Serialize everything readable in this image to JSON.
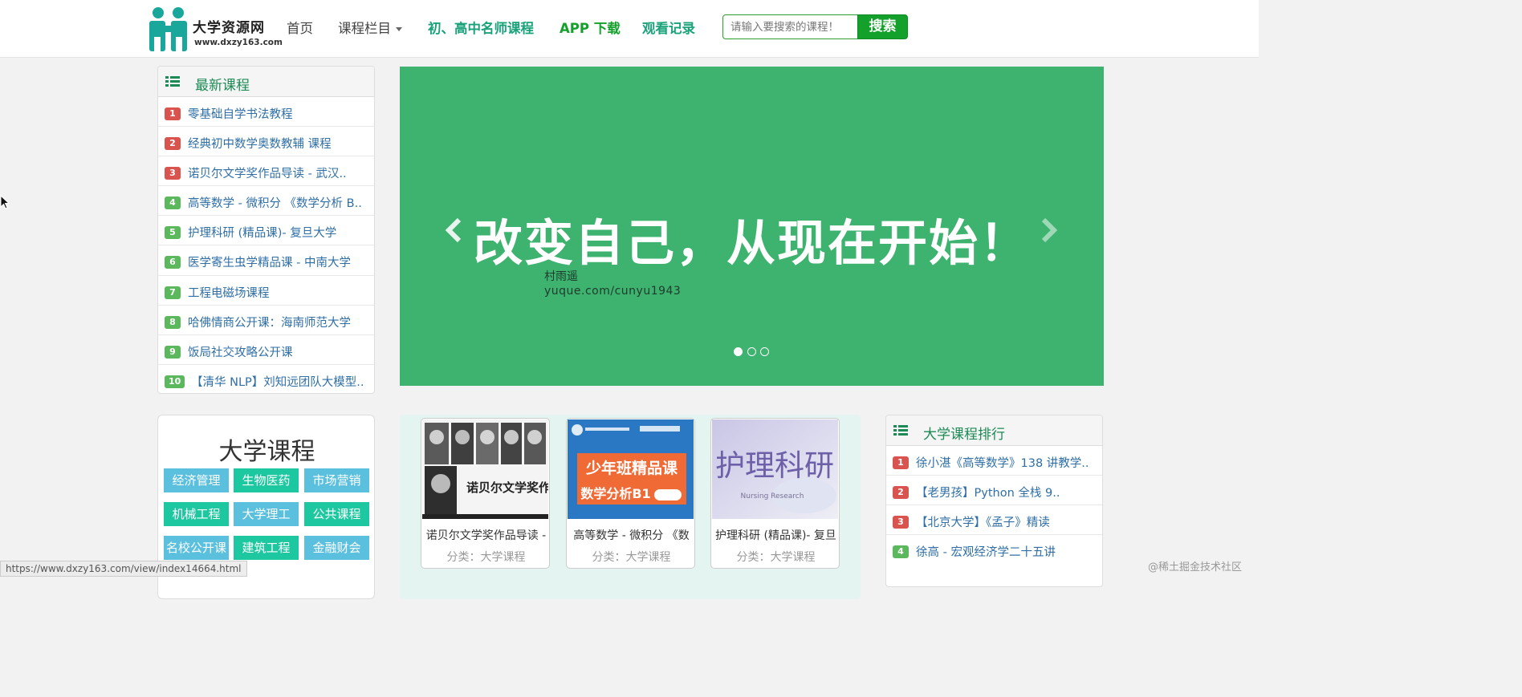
{
  "header": {
    "logo_name": "大学资源网",
    "logo_url": "www.dxzy163.com",
    "nav": {
      "home": "首页",
      "columns": "课程栏目",
      "teachers": "初、高中名师课程",
      "app": "APP 下载",
      "history": "观看记录"
    },
    "search": {
      "placeholder": "请输入要搜索的课程！",
      "button": "搜索"
    }
  },
  "latest": {
    "title": "最新课程",
    "items": [
      {
        "rank": "1",
        "text": "零基础自学书法教程"
      },
      {
        "rank": "2",
        "text": "经典初中数学奥数教辅 课程"
      },
      {
        "rank": "3",
        "text": "诺贝尔文学奖作品导读 - 武汉.."
      },
      {
        "rank": "4",
        "text": "高等数学 - 微积分 《数学分析 B.."
      },
      {
        "rank": "5",
        "text": "护理科研 (精品课)- 复旦大学"
      },
      {
        "rank": "6",
        "text": "医学寄生虫学精品课 - 中南大学"
      },
      {
        "rank": "7",
        "text": "工程电磁场课程"
      },
      {
        "rank": "8",
        "text": "哈佛情商公开课：海南师范大学"
      },
      {
        "rank": "9",
        "text": "饭局社交攻略公开课"
      },
      {
        "rank": "10",
        "text": "【清华 NLP】刘知远团队大模型.."
      }
    ]
  },
  "banner": {
    "slogan": "改变自己，从现在开始！",
    "watermark_name": "村雨遥",
    "watermark_url": "yuque.com/cunyu1943"
  },
  "categories": {
    "title": "大学课程",
    "tags": [
      "经济管理",
      "生物医药",
      "市场营销",
      "机械工程",
      "大学理工",
      "公共课程",
      "名校公开课",
      "建筑工程",
      "金融财会"
    ]
  },
  "courses": [
    {
      "title": "诺贝尔文学奖作品导读 -",
      "category": "分类：大学课程",
      "thumb_text": "诺贝尔文学奖作品导读"
    },
    {
      "title": "高等数学 - 微积分 《数",
      "category": "分类：大学课程",
      "thumb_text": "少年班精品课",
      "thumb_sub": "数学分析B1"
    },
    {
      "title": "护理科研 (精品课)- 复旦",
      "category": "分类：大学课程",
      "thumb_text": "护理科研",
      "thumb_sub": "Nursing Research"
    }
  ],
  "ranking": {
    "title": "大学课程排行",
    "items": [
      {
        "rank": "1",
        "text": "徐小湛《高等数学》138 讲教学.."
      },
      {
        "rank": "2",
        "text": "【老男孩】Python 全栈 9.."
      },
      {
        "rank": "3",
        "text": "【北京大学】《孟子》精读"
      },
      {
        "rank": "4",
        "text": "徐高 - 宏观经济学二十五讲"
      }
    ]
  },
  "status": {
    "url": "https://www.dxzy163.com/view/index14664.html",
    "corner_watermark": "@稀土掘金技术社区"
  },
  "colors": {
    "brand_green": "#1c8a55",
    "banner_green": "#3eb370",
    "badge_red": "#d9534f",
    "badge_green": "#5cb85c"
  }
}
